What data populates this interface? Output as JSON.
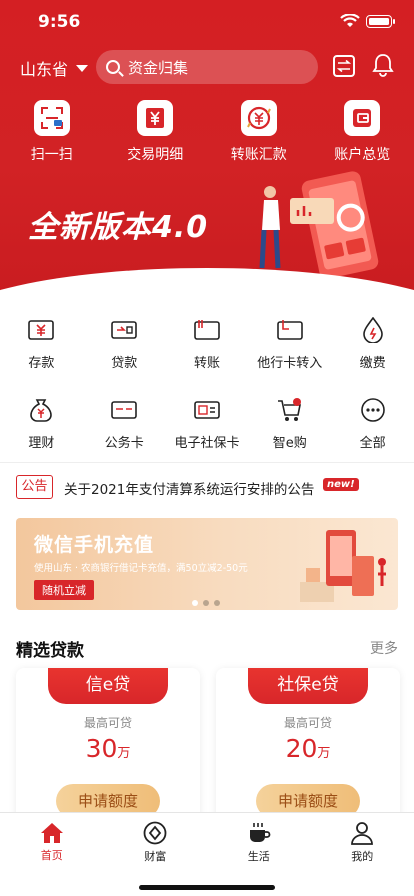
{
  "status_bar": {
    "time": "9:56"
  },
  "header": {
    "region": "山东省",
    "search_placeholder": "资金归集"
  },
  "quick_actions": [
    {
      "label": "扫一扫",
      "icon": "scan-icon"
    },
    {
      "label": "交易明细",
      "icon": "yuan-receipt-icon"
    },
    {
      "label": "转账汇款",
      "icon": "transfer-yuan-icon"
    },
    {
      "label": "账户总览",
      "icon": "account-card-icon"
    }
  ],
  "hero_banner": {
    "text": "全新版本4.0"
  },
  "services": [
    {
      "label": "存款",
      "icon": "deposit-icon"
    },
    {
      "label": "贷款",
      "icon": "loan-icon"
    },
    {
      "label": "转账",
      "icon": "transfer-icon"
    },
    {
      "label": "他行卡转入",
      "icon": "card-in-icon"
    },
    {
      "label": "缴费",
      "icon": "fee-icon"
    },
    {
      "label": "理财",
      "icon": "wealth-bag-icon"
    },
    {
      "label": "公务卡",
      "icon": "official-card-icon"
    },
    {
      "label": "电子社保卡",
      "icon": "social-card-icon"
    },
    {
      "label": "智e购",
      "icon": "cart-icon"
    },
    {
      "label": "全部",
      "icon": "more-icon"
    }
  ],
  "notice": {
    "tag": "公告",
    "text": "关于2021年支付清算系统运行安排的公告",
    "badge": "new!"
  },
  "promo": {
    "title": "微信手机充值",
    "subtitle": "使用山东 · 农商银行借记卡充值，满50立减2-50元",
    "button": "随机立减",
    "page_count": 3,
    "active_page": 1
  },
  "loans": {
    "title": "精选贷款",
    "more": "更多",
    "cards": [
      {
        "name": "信e贷",
        "caption": "最高可贷",
        "amount": "30",
        "unit": "万",
        "button": "申请额度"
      },
      {
        "name": "社保e贷",
        "caption": "最高可贷",
        "amount": "20",
        "unit": "万",
        "button": "申请额度"
      }
    ]
  },
  "tabbar": [
    {
      "label": "首页",
      "icon": "home-icon",
      "active": true
    },
    {
      "label": "财富",
      "icon": "wealth-icon",
      "active": false
    },
    {
      "label": "生活",
      "icon": "coffee-icon",
      "active": false
    },
    {
      "label": "我的",
      "icon": "user-icon",
      "active": false
    }
  ],
  "colors": {
    "brand_red": "#d8262a",
    "gold": "#efbd78"
  }
}
